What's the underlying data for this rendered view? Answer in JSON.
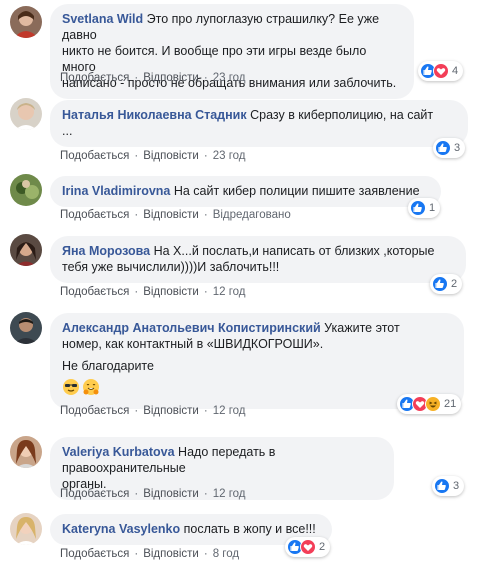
{
  "labels": {
    "like": "Подобається",
    "reply": "Відповісти"
  },
  "colors": {
    "link": "#385898",
    "bubble": "#f2f3f5",
    "like": "#1877f2",
    "love": "#f33e58",
    "haha": "#f7b125"
  },
  "comments": [
    {
      "author": "Svetlana Wild",
      "text_lines": [
        "Это про лупоглазую страшилку? Ее уже давно",
        "никто не боится. И вообще про эти игры везде было много",
        "написано - просто не обращать внимания или заблочить."
      ],
      "time": "23 год",
      "reactions": [
        "like-icon",
        "love-icon"
      ],
      "count": "4"
    },
    {
      "author": "Наталья Николаевна Стадник",
      "text_lines": [
        "Сразу в киберполицию, на сайт",
        "..."
      ],
      "time": "23 год",
      "reactions": [
        "like-icon"
      ],
      "count": "3"
    },
    {
      "author": "Irina Vladimirovna",
      "text_lines": [
        "На сайт кибер полиции пишите заявление"
      ],
      "time": "Відредаговано",
      "reactions": [
        "like-icon"
      ],
      "count": "1"
    },
    {
      "author": "Яна Морозова",
      "text_lines": [
        "На Х...й послать,и написать от близких ,которые",
        "тебя уже вычислили))))И заблочить!!!"
      ],
      "time": "12 год",
      "reactions": [
        "like-icon"
      ],
      "count": "2"
    },
    {
      "author": "Александр Анатольевич Копистиринский",
      "text_lines": [
        "Укажите этот",
        "номер, как контактный в «ШВИДКОГРОШИ».",
        "",
        "Не благодарите"
      ],
      "emojis": [
        "sunglasses-emoji",
        "hug-emoji"
      ],
      "time": "12 год",
      "reactions": [
        "like-icon",
        "love-icon",
        "haha-icon"
      ],
      "count": "21"
    },
    {
      "author": "Valeriya Kurbatova",
      "text_lines": [
        "Надо передать в правоохранительные",
        "органы."
      ],
      "time": "12 год",
      "reactions": [
        "like-icon"
      ],
      "count": "3"
    },
    {
      "author": "Kateryna Vasylenko",
      "text_lines": [
        "послать в жопу и все!!!"
      ],
      "time": "8 год",
      "reactions": [
        "like-icon",
        "love-icon"
      ],
      "count": "2"
    }
  ]
}
